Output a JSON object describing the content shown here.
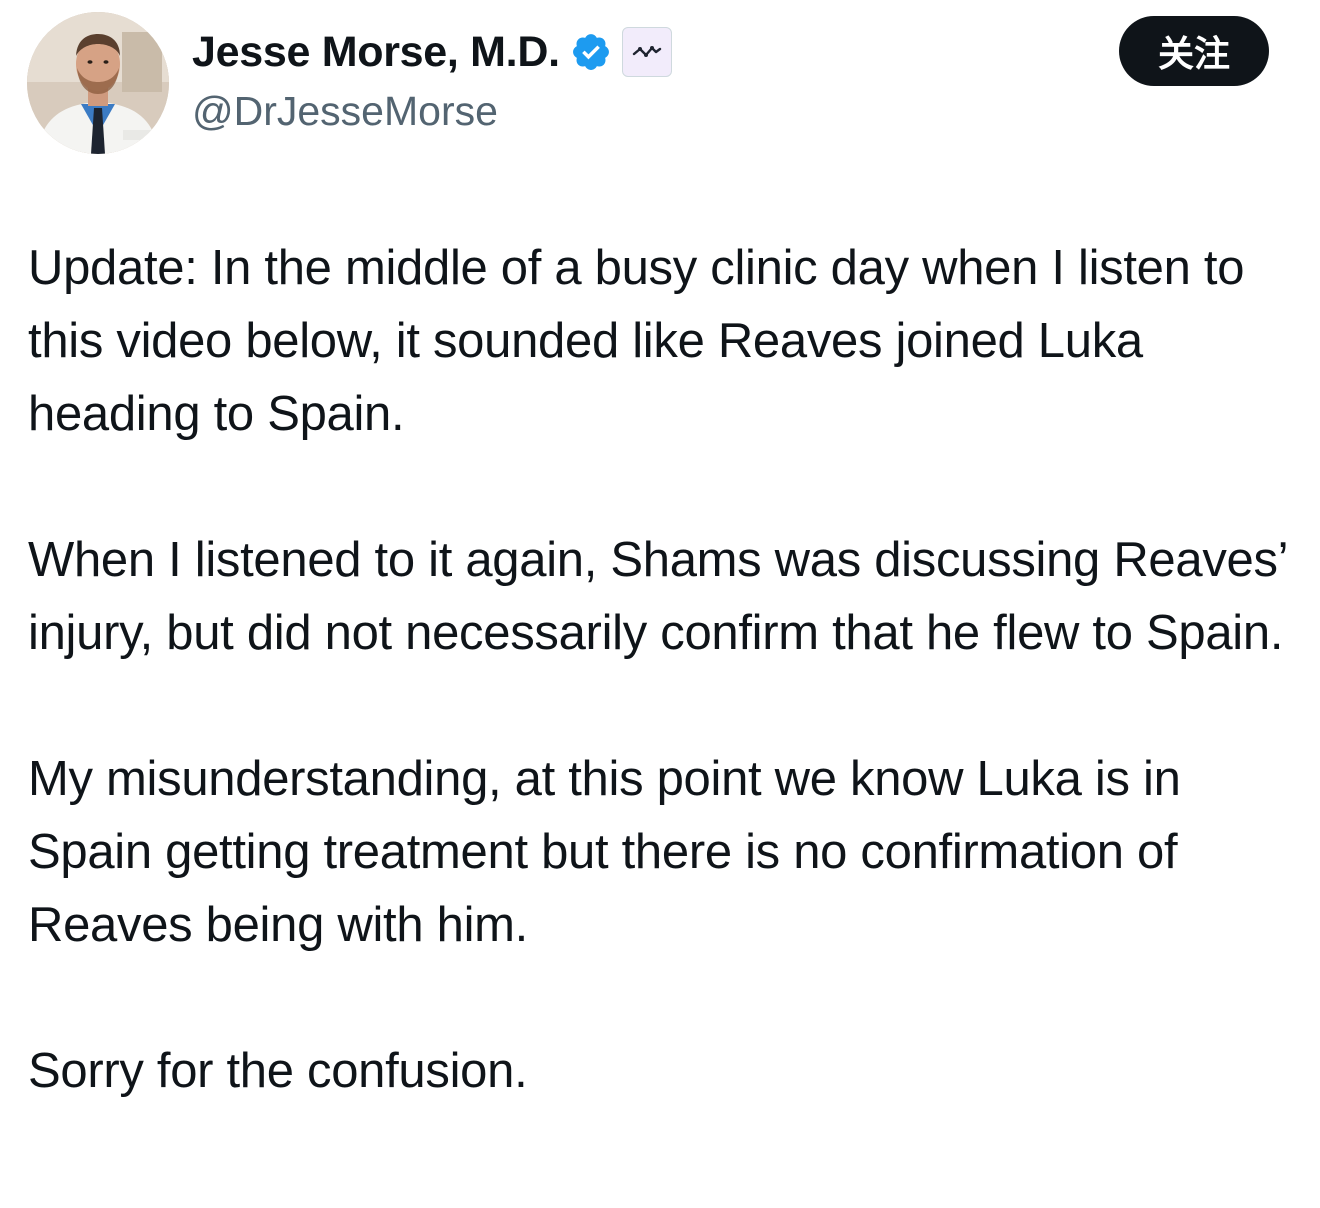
{
  "author": {
    "display_name": "Jesse Morse, M.D.",
    "handle": "@DrJesseMorse",
    "verified_icon": "verified-badge-icon",
    "affiliation_icon": "affiliate-badge-icon",
    "avatar_icon": "profile-photo"
  },
  "actions": {
    "follow_label": "关注"
  },
  "tweet": {
    "paragraphs": [
      "Update: In the middle of a busy clinic day when I listen to this video below, it sounded like Reaves joined Luka heading to Spain.",
      "When I listened to it again, Shams was discussing Reaves’ injury, but did not necessarily confirm that he flew to Spain.",
      "My misunderstanding, at this point we know Luka is in Spain getting treatment but there is no confirmation of Reaves being with him.",
      "Sorry for the confusion."
    ]
  },
  "colors": {
    "text_primary": "#0f1419",
    "text_secondary": "#536471",
    "verified_blue": "#1d9bf0",
    "follow_button_bg": "#0f1419",
    "follow_button_text": "#ffffff"
  }
}
